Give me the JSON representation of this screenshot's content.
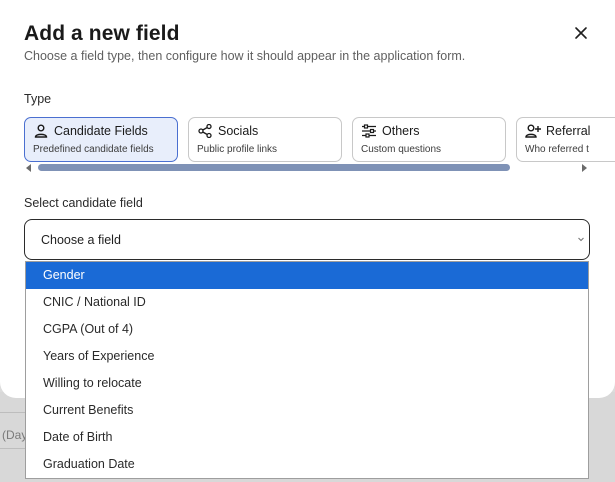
{
  "dialog": {
    "title": "Add a new field",
    "subtitle": "Choose a field type, then configure how it should appear in the application form."
  },
  "type_section": {
    "label": "Type",
    "cards": [
      {
        "name": "Candidate Fields",
        "desc": "Predefined candidate fields",
        "icon": "person-icon",
        "selected": true
      },
      {
        "name": "Socials",
        "desc": "Public profile links",
        "icon": "share-icon",
        "selected": false
      },
      {
        "name": "Others",
        "desc": "Custom questions",
        "icon": "sliders-icon",
        "selected": false
      },
      {
        "name": "Referral",
        "desc": "Who referred t",
        "icon": "person-add-icon",
        "selected": false
      }
    ]
  },
  "candidate_field": {
    "label": "Select candidate field",
    "value": "Choose a field"
  },
  "dropdown": {
    "options": [
      "Gender",
      "CNIC / National ID",
      "CGPA (Out of 4)",
      "Years of Experience",
      "Willing to relocate",
      "Current Benefits",
      "Date of Birth",
      "Graduation Date"
    ],
    "highlighted": "Gender"
  },
  "background": {
    "partial_text": "(Day"
  },
  "colors": {
    "accent": "#1a6ad6",
    "selected_card_bg": "#e8eefb",
    "selected_card_border": "#4a6fd0",
    "scroll_thumb": "#7f92b6"
  }
}
